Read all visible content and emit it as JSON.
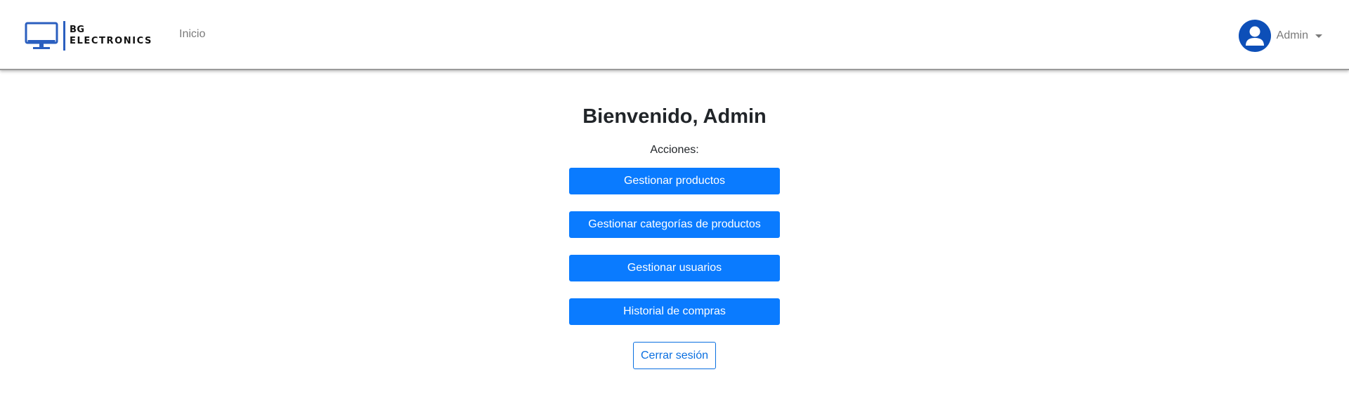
{
  "navbar": {
    "brand": {
      "line1": "BG",
      "line2": "ELECTRONICS",
      "icon": "monitor-icon",
      "color": "#2b5fbf"
    },
    "links": [
      {
        "label": "Inicio"
      }
    ],
    "user": {
      "name": "Admin",
      "avatar_icon": "user-avatar-icon",
      "avatar_color": "#0d4fb8"
    }
  },
  "main": {
    "title": "Bienvenido, Admin",
    "actions_label": "Acciones:",
    "actions": [
      {
        "label": "Gestionar productos"
      },
      {
        "label": "Gestionar categorías de productos"
      },
      {
        "label": "Gestionar usuarios"
      },
      {
        "label": "Historial de compras"
      }
    ],
    "logout_label": "Cerrar sesión"
  },
  "colors": {
    "primary": "#0a7bff",
    "outline": "#0a6fe0"
  }
}
